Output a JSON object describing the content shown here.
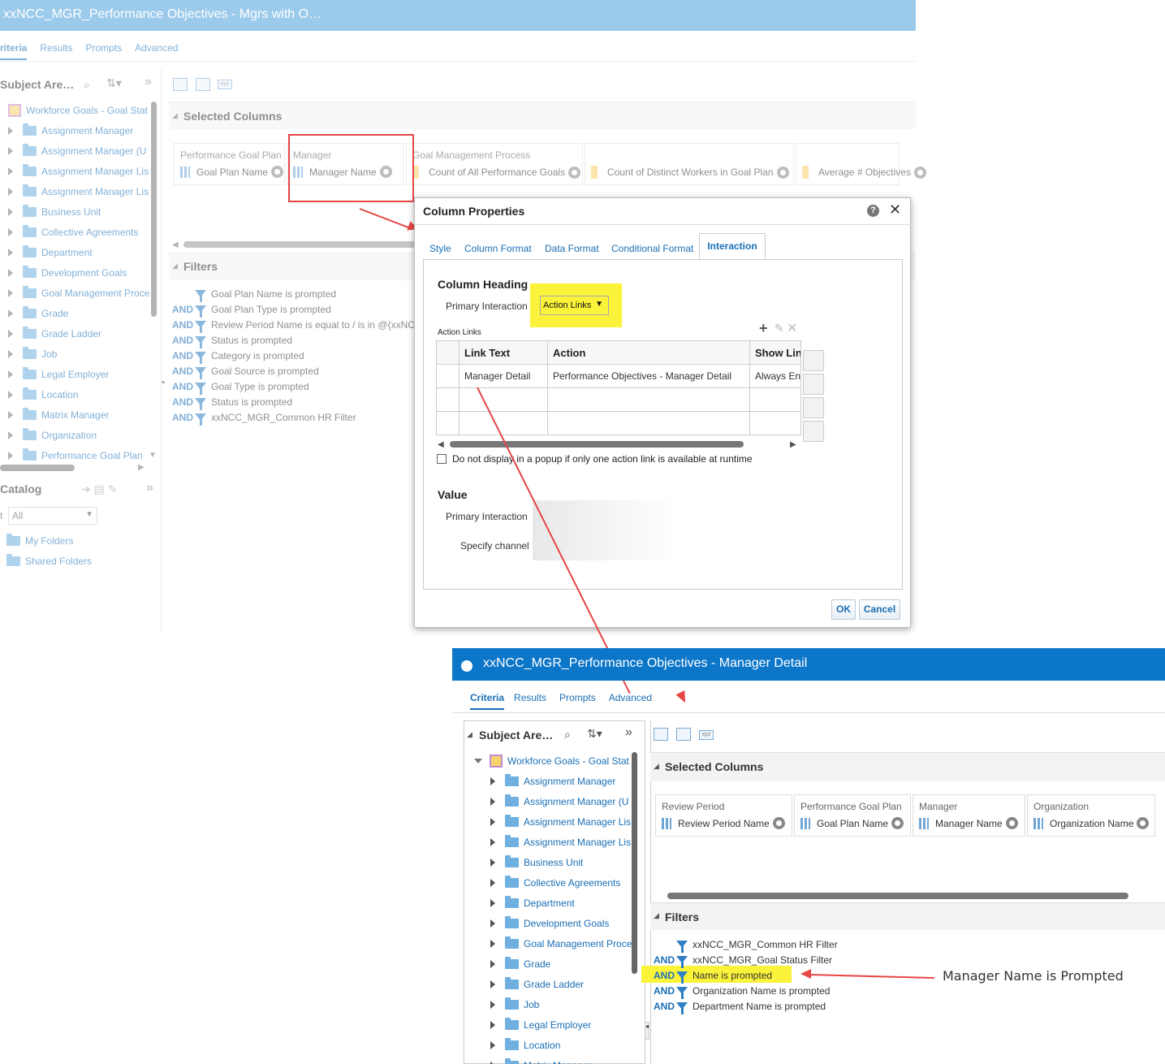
{
  "top_window": {
    "title": "xxNCC_MGR_Performance Objectives - Mgrs with O…",
    "tabs": [
      "riteria",
      "Results",
      "Prompts",
      "Advanced"
    ],
    "subject_areas_label": "Subject Are…",
    "subject_area_root": "Workforce Goals - Goal Stat",
    "tree_items": [
      "Assignment Manager",
      "Assignment Manager (U",
      "Assignment Manager Lis",
      "Assignment Manager Lis",
      "Business Unit",
      "Collective Agreements",
      "Department",
      "Development Goals",
      "Goal Management Proce",
      "Grade",
      "Grade Ladder",
      "Job",
      "Legal Employer",
      "Location",
      "Matrix Manager",
      "Organization",
      "Performance Goal Plan"
    ],
    "catalog_label": "Catalog",
    "catalog_filter_prefix": "t",
    "catalog_filter_value": "All",
    "catalog_items": [
      "My Folders",
      "Shared Folders"
    ],
    "selected_columns_label": "Selected Columns",
    "columns": [
      {
        "group": "Performance Goal Plan",
        "name": "Goal Plan Name"
      },
      {
        "group": "Manager",
        "name": "Manager Name"
      },
      {
        "group": "Goal Management Process",
        "name": "Count of All Performance Goals"
      },
      {
        "group": "",
        "name": "Count of Distinct Workers in Goal Plan"
      },
      {
        "group": "",
        "name": "Average # Objectives"
      }
    ],
    "filters_label": "Filters",
    "filters": [
      {
        "and": "",
        "text": "Goal Plan Name is prompted"
      },
      {
        "and": "AND",
        "text": "Goal Plan Type is prompted"
      },
      {
        "and": "AND",
        "text": "Review Period Name is equal to / is in  @{xxNC"
      },
      {
        "and": "AND",
        "text": "Status is prompted"
      },
      {
        "and": "AND",
        "text": "Category is prompted"
      },
      {
        "and": "AND",
        "text": "Goal Source is prompted"
      },
      {
        "and": "AND",
        "text": "Goal Type is prompted"
      },
      {
        "and": "AND",
        "text": "Status is prompted"
      },
      {
        "and": "AND",
        "text": " xxNCC_MGR_Common HR Filter"
      }
    ]
  },
  "dialog": {
    "title": "Column Properties",
    "tabs": [
      "Style",
      "Column Format",
      "Data Format",
      "Conditional Format",
      "Interaction"
    ],
    "column_heading_label": "Column Heading",
    "primary_interaction_label": "Primary Interaction",
    "primary_interaction_value": "Action Links",
    "action_links_label": "Action Links",
    "table_headers": [
      "Link Text",
      "Action",
      "Show Lin"
    ],
    "table_rows": [
      [
        "Manager Detail",
        "Performance Objectives - Manager Detail",
        "Always Ena"
      ],
      [
        "",
        "",
        ""
      ],
      [
        "",
        "",
        ""
      ]
    ],
    "popup_checkbox_label": "Do not display in a popup if only one action link is available at runtime",
    "value_label": "Value",
    "value_primary_interaction_label": "Primary Interaction",
    "specify_channel_label": "Specify channel",
    "ok_label": "OK",
    "cancel_label": "Cancel"
  },
  "bottom_window": {
    "title": "xxNCC_MGR_Performance Objectives - Manager Detail",
    "tabs": [
      "Criteria",
      "Results",
      "Prompts",
      "Advanced"
    ],
    "subject_areas_label": "Subject Are…",
    "subject_area_root": "Workforce Goals - Goal Stat",
    "tree_items": [
      "Assignment Manager",
      "Assignment Manager (U",
      "Assignment Manager Lis",
      "Assignment Manager Lis",
      "Business Unit",
      "Collective Agreements",
      "Department",
      "Development Goals",
      "Goal Management Proce",
      "Grade",
      "Grade Ladder",
      "Job",
      "Legal Employer",
      "Location",
      "Matrix Manager"
    ],
    "selected_columns_label": "Selected Columns",
    "columns": [
      {
        "group": "Review Period",
        "name": "Review Period Name"
      },
      {
        "group": "Performance Goal Plan",
        "name": "Goal Plan Name"
      },
      {
        "group": "Manager",
        "name": "Manager Name"
      },
      {
        "group": "Organization",
        "name": "Organization Name"
      }
    ],
    "filters_label": "Filters",
    "filters": [
      {
        "and": "",
        "text": "xxNCC_MGR_Common HR Filter"
      },
      {
        "and": "AND",
        "text": "xxNCC_MGR_Goal Status Filter"
      },
      {
        "and": "AND",
        "text": "Name is prompted"
      },
      {
        "and": "AND",
        "text": "Organization Name is prompted"
      },
      {
        "and": "AND",
        "text": "Department Name is prompted"
      }
    ]
  },
  "annotation": "Manager Name is Prompted",
  "colors": {
    "accent": "#1a6fb5",
    "highlight": "#fbf23a",
    "arrow": "#e84545",
    "title_bar": "#0c76c8"
  }
}
